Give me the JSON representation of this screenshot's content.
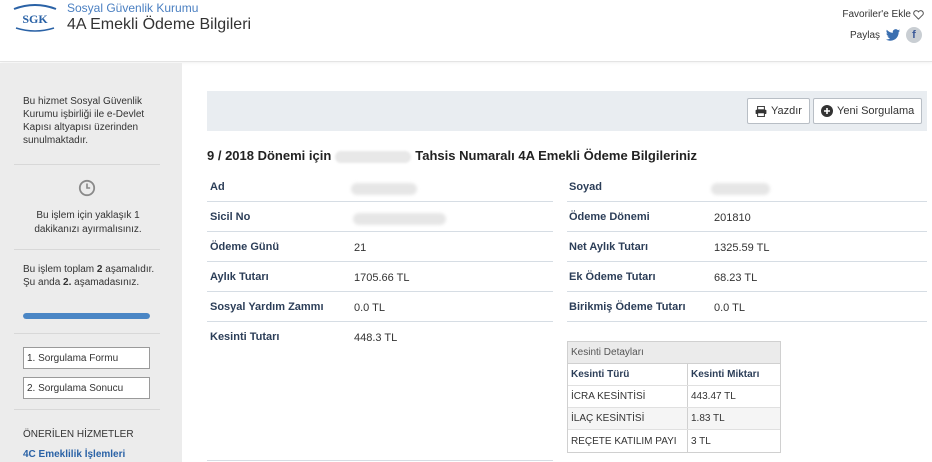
{
  "header": {
    "org_name": "Sosyal Güvenlik Kurumu",
    "page_title": "4A Emekli Ödeme Bilgileri",
    "favorites_label": "Favoriler'e Ekle",
    "share_label": "Paylaş",
    "logo_text": "SGK"
  },
  "sidebar": {
    "info_text": "Bu hizmet Sosyal Güvenlik Kurumu işbirliği ile e-Devlet Kapısı altyapısı üzerinden sunulmaktadır.",
    "time_text": "Bu işlem için yaklaşık 1 dakikanızı ayırmalısınız.",
    "steps_line1_a": "Bu işlem toplam ",
    "steps_total": "2",
    "steps_line1_b": " aşamalıdır.",
    "steps_line2_a": "Şu anda ",
    "steps_current": "2.",
    "steps_line2_b": " aşamadasınız.",
    "progress_fraction": 1.0,
    "step_buttons": [
      "1. Sorgulama Formu",
      "2. Sorgulama Sonucu"
    ],
    "recommended_heading": "ÖNERİLEN HİZMETLER",
    "recommended_link": "4C Emeklilik İşlemleri"
  },
  "toolbar": {
    "print_label": "Yazdır",
    "new_query_label": "Yeni Sorgulama"
  },
  "main": {
    "title_prefix": "9 / 2018 Dönemi için",
    "title_suffix": "Tahsis Numaralı 4A Emekli Ödeme Bilgileriniz",
    "fields": {
      "ad_label": "Ad",
      "soyad_label": "Soyad",
      "sicil_label": "Sicil No",
      "odeme_donemi_label": "Ödeme Dönemi",
      "odeme_donemi_value": "201810",
      "odeme_gunu_label": "Ödeme Günü",
      "odeme_gunu_value": "21",
      "net_aylik_label": "Net Aylık Tutarı",
      "net_aylik_value": "1325.59 TL",
      "aylik_tutari_label": "Aylık Tutarı",
      "aylik_tutari_value": "1705.66 TL",
      "ek_odeme_label": "Ek Ödeme Tutarı",
      "ek_odeme_value": "68.23 TL",
      "sosyal_yardim_label": "Sosyal Yardım Zammı",
      "sosyal_yardim_value": "0.0 TL",
      "birikmis_label": "Birikmiş Ödeme Tutarı",
      "birikmis_value": "0.0 TL",
      "kesinti_label": "Kesinti Tutarı",
      "kesinti_value": "448.3 TL"
    },
    "kesinti_table": {
      "caption": "Kesinti Detayları",
      "headers": [
        "Kesinti Türü",
        "Kesinti Miktarı"
      ],
      "rows": [
        [
          "İCRA KESİNTİSİ",
          "443.47 TL"
        ],
        [
          "İLAÇ KESİNTİSİ",
          "1.83 TL"
        ],
        [
          "REÇETE KATILIM PAYI",
          "3 TL"
        ]
      ]
    }
  },
  "colors": {
    "accent_blue": "#4a86c5",
    "label_navy": "#2c3e58",
    "sidebar_bg": "#ececec"
  }
}
